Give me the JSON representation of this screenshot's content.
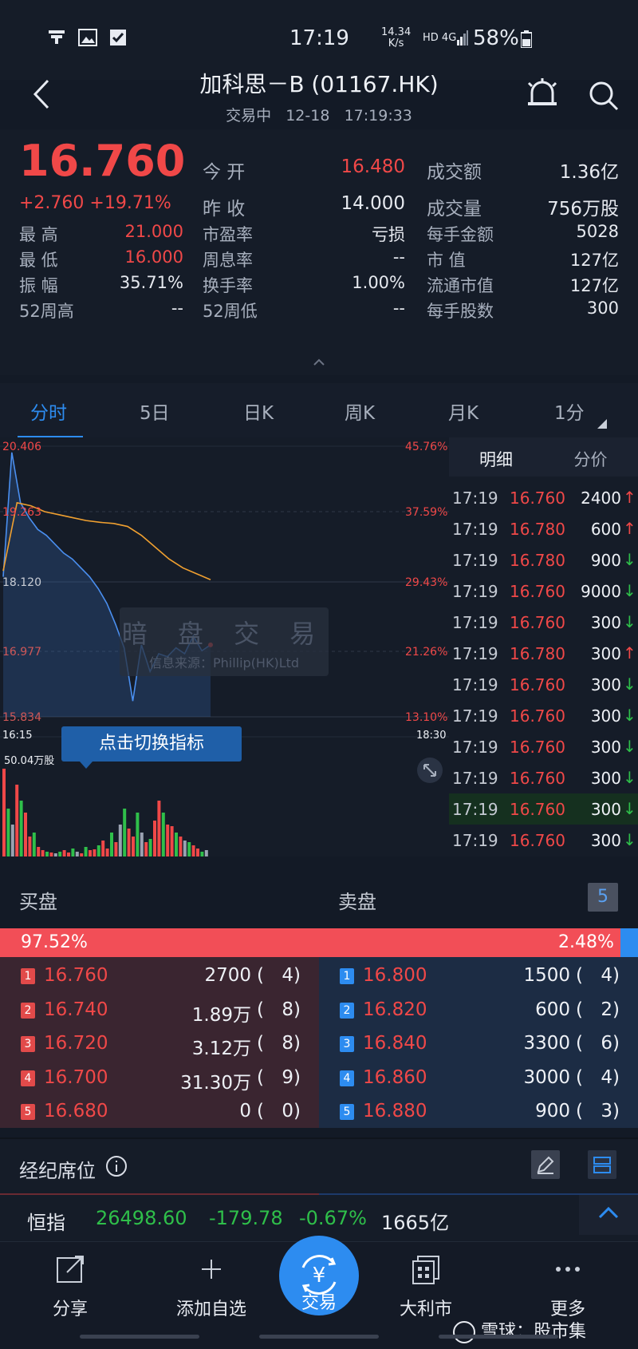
{
  "status_bar": {
    "time": "17:19",
    "speed": "14.34",
    "speed_unit": "K/s",
    "network": "HD 4G",
    "battery": "58%"
  },
  "header": {
    "title": "加科思－B (01167.HK)",
    "status": "交易中",
    "date": "12-18",
    "clock": "17:19:33"
  },
  "quote": {
    "price": "16.760",
    "change": "+2.760",
    "change_pct": "+19.71%",
    "open_label": "今 开",
    "open": "16.480",
    "prev_label": "昨 收",
    "prev": "14.000",
    "turnover_label": "成交额",
    "turnover": "1.36亿",
    "volume_label": "成交量",
    "volume": "756万股",
    "rows": [
      {
        "l1": "最 高",
        "v1": "21.000",
        "l2": "市盈率",
        "v2": "亏损",
        "l3": "每手金额",
        "v3": "5028"
      },
      {
        "l1": "最 低",
        "v1": "16.000",
        "l2": "周息率",
        "v2": "--",
        "l3": "市 值",
        "v3": "127亿"
      },
      {
        "l1": "振 幅",
        "v1": "35.71%",
        "l2": "换手率",
        "v2": "1.00%",
        "l3": "流通市值",
        "v3": "127亿"
      },
      {
        "l1": "52周高",
        "v1": "--",
        "l2": "52周低",
        "v2": "--",
        "l3": "每手股数",
        "v3": "300"
      }
    ]
  },
  "tabs": [
    "分时",
    "5日",
    "日K",
    "周K",
    "月K",
    "1分"
  ],
  "chart": {
    "y_left": [
      "20.406",
      "19.263",
      "18.120",
      "16.977",
      "15.834"
    ],
    "y_right": [
      "45.76%",
      "37.59%",
      "29.43%",
      "21.26%",
      "13.10%"
    ],
    "x_start": "16:15",
    "x_end": "18:30",
    "watermark_title": "暗 盘 交 易",
    "watermark_source": "信息来源：Phillip(HK)Ltd",
    "tooltip": "点击切换指标",
    "volume_label": "50.04万股"
  },
  "chart_data": {
    "type": "line",
    "title": "",
    "xlabel": "",
    "ylabel": "",
    "ylim": [
      15.834,
      20.406
    ],
    "x_range": [
      "16:15",
      "18:30"
    ],
    "series": [
      {
        "values": [
          18.2,
          20.3,
          19.45,
          19.2,
          19.0,
          18.9,
          18.75,
          18.6,
          18.5,
          18.35,
          18.2,
          18.0,
          17.75,
          17.4,
          17.0,
          16.1,
          17.05,
          16.6,
          16.9,
          16.85,
          17.0,
          16.9,
          17.2,
          16.95,
          17.05
        ]
      },
      {
        "values": [
          18.3,
          19.45,
          19.4,
          19.3,
          19.25,
          19.2,
          19.15,
          19.12,
          19.1,
          19.05,
          18.9,
          18.7,
          18.5,
          18.35,
          18.25,
          18.15
        ]
      }
    ]
  },
  "detail_tabs": [
    "明细",
    "分价"
  ],
  "trades": [
    {
      "t": "17:19",
      "p": "16.760",
      "v": "2400",
      "d": "↑",
      "c": "red"
    },
    {
      "t": "17:19",
      "p": "16.780",
      "v": "600",
      "d": "↑",
      "c": "red"
    },
    {
      "t": "17:19",
      "p": "16.780",
      "v": "900",
      "d": "↓",
      "c": "green"
    },
    {
      "t": "17:19",
      "p": "16.760",
      "v": "9000",
      "d": "↓",
      "c": "green"
    },
    {
      "t": "17:19",
      "p": "16.760",
      "v": "300",
      "d": "↓",
      "c": "green"
    },
    {
      "t": "17:19",
      "p": "16.780",
      "v": "300",
      "d": "↑",
      "c": "red"
    },
    {
      "t": "17:19",
      "p": "16.760",
      "v": "300",
      "d": "↓",
      "c": "green"
    },
    {
      "t": "17:19",
      "p": "16.760",
      "v": "300",
      "d": "↓",
      "c": "green"
    },
    {
      "t": "17:19",
      "p": "16.760",
      "v": "300",
      "d": "↓",
      "c": "green"
    },
    {
      "t": "17:19",
      "p": "16.760",
      "v": "300",
      "d": "↓",
      "c": "green"
    },
    {
      "t": "17:19",
      "p": "16.760",
      "v": "300",
      "d": "↓",
      "c": "green"
    },
    {
      "t": "17:19",
      "p": "16.760",
      "v": "300",
      "d": "↓",
      "c": "green"
    }
  ],
  "book": {
    "buy_label": "买盘",
    "sell_label": "卖盘",
    "depth": "5",
    "buy_pct": "97.52%",
    "sell_pct": "2.48%",
    "bids": [
      {
        "n": "1",
        "p": "16.760",
        "q": "2700",
        "c": "4"
      },
      {
        "n": "2",
        "p": "16.740",
        "q": "1.89万",
        "c": "8"
      },
      {
        "n": "3",
        "p": "16.720",
        "q": "3.12万",
        "c": "8"
      },
      {
        "n": "4",
        "p": "16.700",
        "q": "31.30万",
        "c": "9"
      },
      {
        "n": "5",
        "p": "16.680",
        "q": "0",
        "c": "0"
      }
    ],
    "asks": [
      {
        "n": "1",
        "p": "16.800",
        "q": "1500",
        "c": "4"
      },
      {
        "n": "2",
        "p": "16.820",
        "q": "600",
        "c": "2"
      },
      {
        "n": "3",
        "p": "16.840",
        "q": "3300",
        "c": "6"
      },
      {
        "n": "4",
        "p": "16.860",
        "q": "3000",
        "c": "4"
      },
      {
        "n": "5",
        "p": "16.880",
        "q": "900",
        "c": "3"
      }
    ]
  },
  "broker": {
    "label": "经纪席位"
  },
  "index_bar": {
    "name": "恒指",
    "value": "26498.60",
    "change": "-179.78",
    "pct": "-0.67%",
    "turnover": "1665亿"
  },
  "nav": {
    "share": "分享",
    "add": "添加自选",
    "trade": "交易",
    "dalishi": "大利市",
    "more": "更多",
    "watermark": "雪球：股市集"
  },
  "colors": {
    "up": "#f04848",
    "down": "#2fbf4a",
    "accent": "#2d8cf0"
  }
}
